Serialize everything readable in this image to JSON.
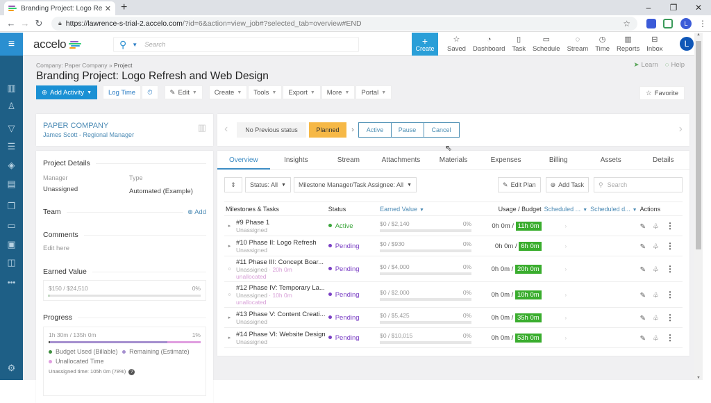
{
  "browser": {
    "tab_title": "Branding Project: Logo Refresh a",
    "new_tab": "+",
    "url_host": "https://lawrence-s-trial-2.accelo.com",
    "url_path": "/?id=6&action=view_job#?selected_tab=overview#END",
    "profile_initial": "L"
  },
  "topnav": {
    "logo": "accelo",
    "search_placeholder": "Search",
    "create_label": "Create",
    "items": [
      {
        "label": "Saved",
        "icon": "star-icon",
        "glyph": "☆"
      },
      {
        "label": "Dashboard",
        "icon": "gauge-icon",
        "glyph": "◔"
      },
      {
        "label": "Task",
        "icon": "clipboard-icon",
        "glyph": "▯"
      },
      {
        "label": "Schedule",
        "icon": "calendar-icon",
        "glyph": "▭"
      },
      {
        "label": "Stream",
        "icon": "chat-icon",
        "glyph": "◌"
      },
      {
        "label": "Time",
        "icon": "clock-icon",
        "glyph": "◷"
      },
      {
        "label": "Reports",
        "icon": "bar-chart-icon",
        "glyph": "▥"
      },
      {
        "label": "Inbox",
        "icon": "inbox-icon",
        "glyph": "⊟"
      }
    ],
    "avatar_initial": "L"
  },
  "sidebar": {
    "icons": [
      "building-icon",
      "person-icon",
      "funnel-icon",
      "gantt-icon",
      "tag-icon",
      "report-refresh-icon",
      "documents-icon",
      "ticket-icon",
      "receipt-icon",
      "bag-icon",
      "more-icon",
      "settings-icon"
    ]
  },
  "page": {
    "breadcrumb_company": "Company: Paper Company",
    "breadcrumb_sep": "»",
    "breadcrumb_current": "Project",
    "title": "Branding Project: Logo Refresh and Web Design",
    "learn": "Learn",
    "help": "Help",
    "favorite": "Favorite"
  },
  "actions": {
    "add_activity": "Add Activity",
    "log_time": "Log Time",
    "edit": "Edit",
    "create": "Create",
    "tools": "Tools",
    "export": "Export",
    "more": "More",
    "portal": "Portal"
  },
  "company": {
    "name": "PAPER COMPANY",
    "contact": "James Scott - Regional Manager"
  },
  "details": {
    "heading": "Project Details",
    "manager_label": "Manager",
    "manager_value": "Unassigned",
    "type_label": "Type",
    "type_value": "Automated (Example)",
    "team_heading": "Team",
    "team_add": "Add",
    "comments_heading": "Comments",
    "comments_placeholder": "Edit here",
    "earned_heading": "Earned Value",
    "earned_text": "$150 / $24,510",
    "earned_pct": "0%",
    "earned_fraction": 0.006,
    "progress_heading": "Progress",
    "progress_text": "1h 30m / 135h 0m",
    "progress_pct": "1%",
    "progress_used_fraction": 0.01,
    "progress_remaining_fraction": 0.77,
    "legend_used": "Budget Used (Billable)",
    "legend_remaining": "Remaining (Estimate)",
    "legend_unallocated": "Unallocated Time",
    "unassigned_note": "Unassigned time: 105h 0m (78%)"
  },
  "colors": {
    "used": "#3f8f3f",
    "remaining": "#a58fcf",
    "unallocated": "#e09ee0",
    "active": "#3aa53a",
    "pending": "#7a3fc4",
    "badge": "#3aad2e",
    "planned": "#f6b846"
  },
  "status_bar": {
    "previous": "No Previous status",
    "current": "Planned",
    "options": [
      "Active",
      "Pause",
      "Cancel"
    ]
  },
  "tabs": [
    "Overview",
    "Insights",
    "Stream",
    "Attachments",
    "Materials",
    "Expenses",
    "Billing",
    "Assets",
    "Details"
  ],
  "filters": {
    "status": "Status: All",
    "assignee": "Milestone Manager/Task Assignee: All",
    "edit_plan": "Edit Plan",
    "add_task": "Add Task",
    "search_placeholder": "Search"
  },
  "table": {
    "headers": {
      "name": "Milestones & Tasks",
      "status": "Status",
      "earned": "Earned Value",
      "usage": "Usage / Budget",
      "sched1": "Scheduled ...",
      "sched2": "Scheduled d...",
      "actions": "Actions"
    },
    "rows": [
      {
        "expander": "▸",
        "name": "#9 Phase 1",
        "assignee": "Unassigned",
        "hours": "",
        "unallocated": "",
        "status": "Active",
        "status_color": "#3aa53a",
        "earned": "$0 / $2,140",
        "pct": "0%",
        "used": "0h 0m /",
        "budget": "11h 0m"
      },
      {
        "expander": "▸",
        "name": "#10 Phase II: Logo Refresh",
        "assignee": "Unassigned",
        "hours": "",
        "unallocated": "",
        "status": "Pending",
        "status_color": "#7a3fc4",
        "earned": "$0 / $930",
        "pct": "0%",
        "used": "0h 0m /",
        "budget": "6h 0m"
      },
      {
        "expander": "○",
        "name": "#11 Phase III: Concept Boar...",
        "assignee": "Unassigned",
        "hours": " · 20h 0m",
        "unallocated": "unallocated",
        "status": "Pending",
        "status_color": "#7a3fc4",
        "earned": "$0 / $4,000",
        "pct": "0%",
        "used": "0h 0m /",
        "budget": "20h 0m"
      },
      {
        "expander": "○",
        "name": "#12 Phase IV: Temporary La...",
        "assignee": "Unassigned",
        "hours": " · 10h 0m",
        "unallocated": "unallocated",
        "status": "Pending",
        "status_color": "#7a3fc4",
        "earned": "$0 / $2,000",
        "pct": "0%",
        "used": "0h 0m /",
        "budget": "10h 0m"
      },
      {
        "expander": "▸",
        "name": "#13 Phase V: Content Creati...",
        "assignee": "Unassigned",
        "hours": "",
        "unallocated": "",
        "status": "Pending",
        "status_color": "#7a3fc4",
        "earned": "$0 / $5,425",
        "pct": "0%",
        "used": "0h 0m /",
        "budget": "35h 0m"
      },
      {
        "expander": "▸",
        "name": "#14 Phase VI: Website Design",
        "assignee": "Unassigned",
        "hours": "",
        "unallocated": "",
        "status": "Pending",
        "status_color": "#7a3fc4",
        "earned": "$0 / $10,015",
        "pct": "0%",
        "used": "0h 0m /",
        "budget": "53h 0m"
      }
    ]
  }
}
